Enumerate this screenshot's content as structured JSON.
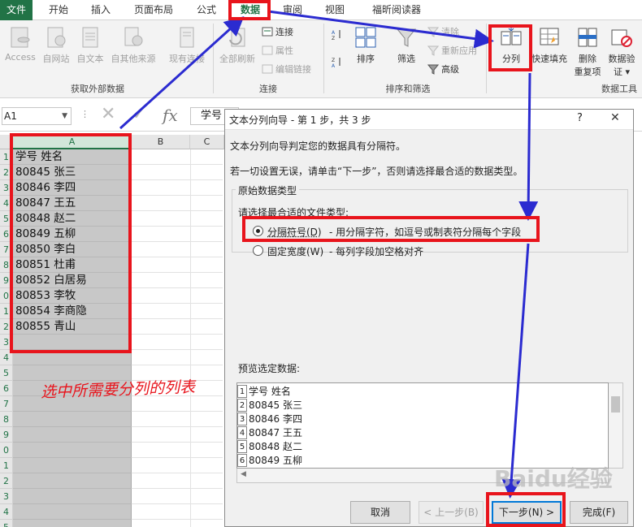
{
  "tabs": [
    {
      "label": "文件"
    },
    {
      "label": "开始"
    },
    {
      "label": "插入"
    },
    {
      "label": "页面布局"
    },
    {
      "label": "公式"
    },
    {
      "label": "数据"
    },
    {
      "label": "审阅"
    },
    {
      "label": "视图"
    },
    {
      "label": "福昕阅读器"
    }
  ],
  "ribbon": {
    "external": {
      "access": "Access",
      "web": "自网站",
      "text": "自文本",
      "other": "自其他来源",
      "existing": "现有连接",
      "group": "获取外部数据"
    },
    "connections": {
      "refresh_all": "全部刷新",
      "connections": "连接",
      "properties": "属性",
      "edit_links": "编辑链接",
      "group": "连接"
    },
    "sort_filter": {
      "sort": "排序",
      "filter": "筛选",
      "clear": "清除",
      "reapply": "重新应用",
      "advanced": "高级",
      "group": "排序和筛选"
    },
    "data_tools": {
      "text_to_columns": "分列",
      "flash_fill": "快速填充",
      "remove_dup_1": "删除",
      "remove_dup_2": "重复项",
      "validation_1": "数据验",
      "validation_2": "证 ▾",
      "group": "数据工具"
    }
  },
  "formula_bar": {
    "name_box": "A1",
    "fx": "fx",
    "formula": "学号"
  },
  "grid": {
    "columns": [
      "A",
      "B",
      "C"
    ],
    "row_numbers": [
      "1",
      "2",
      "3",
      "4",
      "5",
      "6",
      "7",
      "8",
      "9",
      "0",
      "1",
      "2",
      "3",
      "4",
      "5",
      "6",
      "7",
      "8",
      "9",
      "0",
      "1",
      "2",
      "3",
      "4",
      "5"
    ],
    "cells": [
      "学号  姓名",
      "80845  张三",
      "80846  李四",
      "80847  王五",
      "80848  赵二",
      "80849  五柳",
      "80850  李白",
      "80851  杜甫",
      "80852  白居易",
      "80853  李牧",
      "80854  李商隐",
      "80855  青山"
    ]
  },
  "dialog": {
    "title": "文本分列向导 - 第 1 步，共 3 步",
    "help": "?",
    "close": "✕",
    "line1": "文本分列向导判定您的数据具有分隔符。",
    "line2": "若一切设置无误，请单击“下一步”，否则请选择最合适的数据类型。",
    "frame_legend": "原始数据类型",
    "prompt": "请选择最合适的文件类型:",
    "opt1": "分隔符号(D)",
    "opt1_desc": "- 用分隔字符，如逗号或制表符分隔每个字段",
    "opt2": "固定宽度(W)",
    "opt2_desc": "- 每列字段加空格对齐",
    "preview_label": "预览选定数据:",
    "preview_rows": [
      {
        "n": "1",
        "text": "学号  姓名"
      },
      {
        "n": "2",
        "text": "80845  张三"
      },
      {
        "n": "3",
        "text": "80846  李四"
      },
      {
        "n": "4",
        "text": "80847  王五"
      },
      {
        "n": "5",
        "text": "80848  赵二"
      },
      {
        "n": "6",
        "text": "80849  五柳"
      }
    ],
    "buttons": {
      "cancel": "取消",
      "back": "< 上一步(B)",
      "next": "下一步(N) >",
      "finish": "完成(F)"
    }
  },
  "annotation": {
    "note": "选中所需要分列的列表"
  },
  "watermark": "Baidu经验",
  "colors": {
    "excel_green": "#217346",
    "annotation_red": "#e8141c",
    "arrow_blue": "#2b2bd0"
  }
}
